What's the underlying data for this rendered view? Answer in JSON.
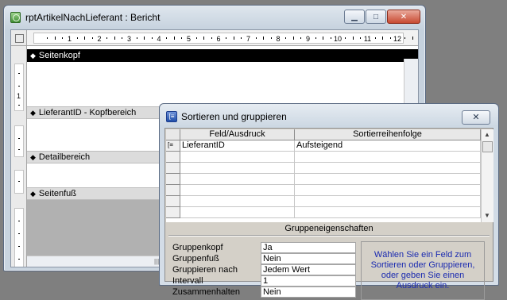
{
  "report_window": {
    "title": "rptArtikelNachLieferant : Bericht",
    "buttons": {
      "minimize": "▁",
      "maximize": "□",
      "close": "✕"
    },
    "ruler_numbers": [
      "1",
      "2",
      "3",
      "4",
      "5",
      "6",
      "7",
      "8",
      "9",
      "10",
      "11",
      "12"
    ],
    "vruler_numbers": [
      "1"
    ],
    "sections": [
      {
        "label": "Seitenkopf",
        "icon": "section-arrow-icon"
      },
      {
        "label": "LieferantID - Kopfbereich",
        "icon": "section-arrow-icon"
      },
      {
        "label": "Detailbereich",
        "icon": "section-arrow-icon"
      },
      {
        "label": "Seitenfuß",
        "icon": "section-arrow-icon"
      }
    ]
  },
  "dialog": {
    "title": "Sortieren und gruppieren",
    "close": "✕",
    "columns": [
      "Feld/Ausdruck",
      "Sortierreihenfolge"
    ],
    "rows": [
      {
        "field": "LieferantID",
        "order": "Aufsteigend"
      }
    ],
    "group_properties_title": "Gruppeneigenschaften",
    "properties": [
      {
        "label": "Gruppenkopf",
        "value": "Ja"
      },
      {
        "label": "Gruppenfuß",
        "value": "Nein"
      },
      {
        "label": "Gruppieren nach",
        "value": "Jedem Wert"
      },
      {
        "label": "Intervall",
        "value": "1"
      },
      {
        "label": "Zusammenhalten",
        "value": "Nein"
      }
    ],
    "hint": "Wählen Sie ein Feld zum Sortieren oder Gruppieren, oder geben Sie einen Ausdruck ein."
  }
}
